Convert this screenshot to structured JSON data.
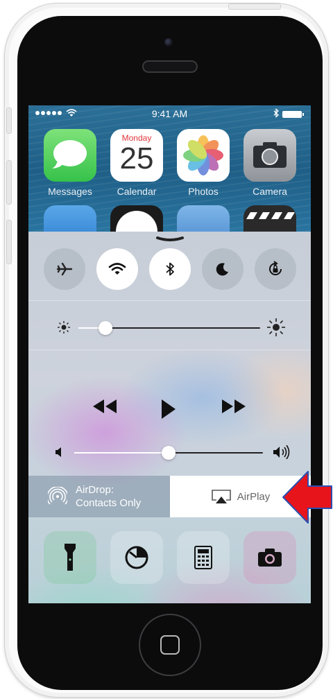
{
  "status_bar": {
    "time": "9:41 AM"
  },
  "home_screen": {
    "apps": [
      {
        "label": "Messages",
        "color": "#4cd964"
      },
      {
        "label": "Calendar",
        "day_name": "Monday",
        "day_number": "25"
      },
      {
        "label": "Photos"
      },
      {
        "label": "Camera"
      }
    ]
  },
  "control_center": {
    "toggles": [
      {
        "name": "airplane-mode",
        "on": false
      },
      {
        "name": "wifi",
        "on": true
      },
      {
        "name": "bluetooth",
        "on": true
      },
      {
        "name": "do-not-disturb",
        "on": false
      },
      {
        "name": "rotation-lock",
        "on": false
      }
    ],
    "brightness_level": 0.15,
    "volume_level": 0.5,
    "airdrop": {
      "line1": "AirDrop:",
      "line2": "Contacts Only"
    },
    "airplay": {
      "label": "AirPlay"
    },
    "shortcuts": [
      "flashlight-icon",
      "timer-icon",
      "calculator-icon",
      "camera-icon"
    ]
  },
  "colors": {
    "annotation_arrow": "#e8141c",
    "annotation_arrow_outline": "#2a4fb0",
    "screen_accent": "#ffffff"
  }
}
